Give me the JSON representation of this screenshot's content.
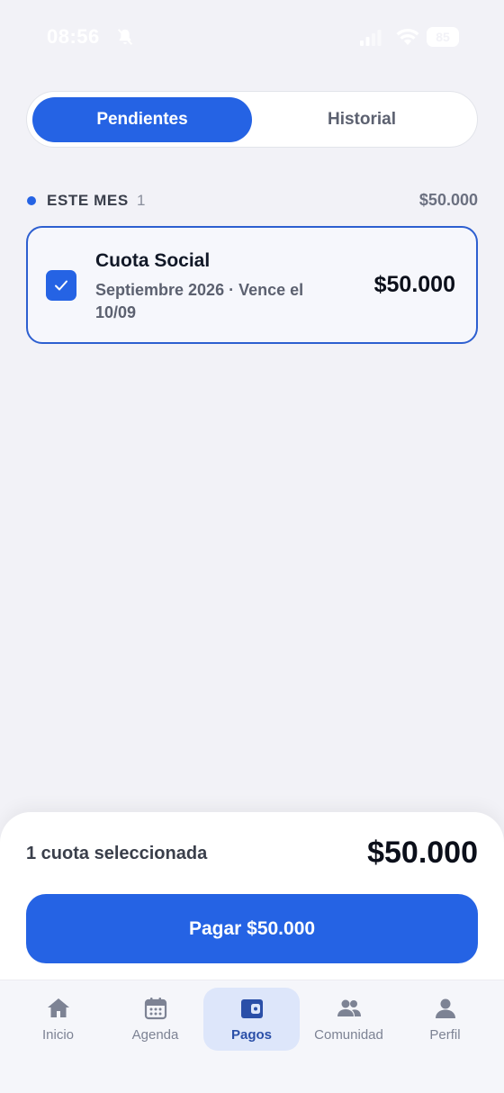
{
  "status_bar": {
    "time": "08:56",
    "battery": "85"
  },
  "tabs": {
    "pending_label": "Pendientes",
    "history_label": "Historial"
  },
  "section": {
    "title": "ESTE MES",
    "count": "1",
    "total": "$50.000"
  },
  "payment": {
    "title": "Cuota Social",
    "subtitle": "Septiembre 2026 · Vence el 10/09",
    "amount": "$50.000",
    "checked": true
  },
  "summary": {
    "selected_label": "1 cuota seleccionada",
    "total": "$50.000",
    "pay_button_label": "Pagar $50.000"
  },
  "nav": {
    "items": [
      {
        "label": "Inicio",
        "icon": "home-icon"
      },
      {
        "label": "Agenda",
        "icon": "calendar-icon"
      },
      {
        "label": "Pagos",
        "icon": "wallet-icon",
        "active": true
      },
      {
        "label": "Comunidad",
        "icon": "people-icon"
      },
      {
        "label": "Perfil",
        "icon": "person-icon"
      }
    ]
  },
  "colors": {
    "accent": "#2563e4",
    "background": "#f2f2f7",
    "nav_active_bg": "#dde6fa"
  }
}
